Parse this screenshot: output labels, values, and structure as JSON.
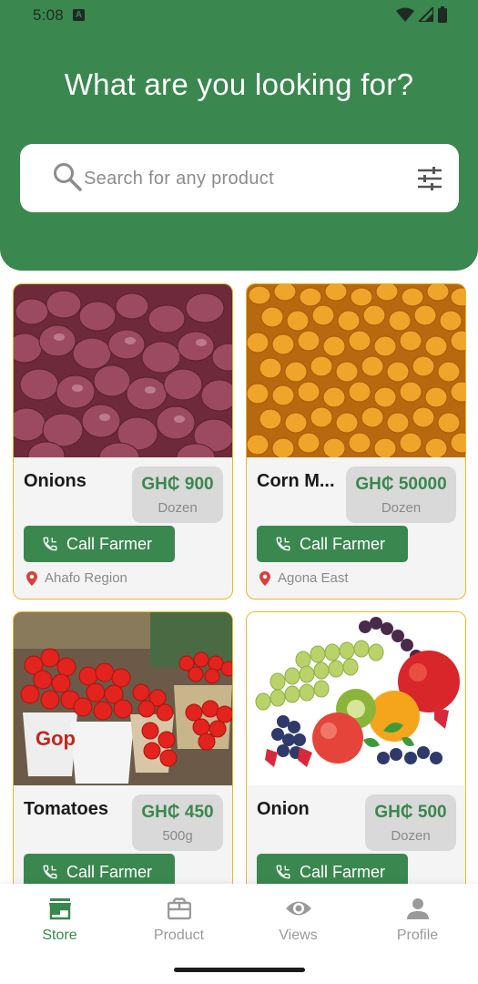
{
  "status_bar": {
    "time": "5:08",
    "notification_badge": "A"
  },
  "header": {
    "title": "What are you looking for?"
  },
  "search": {
    "placeholder": "Search for any product"
  },
  "products": [
    {
      "name": "Onions",
      "price": "GH₵ 900",
      "unit": "Dozen",
      "button": "Call Farmer",
      "location": "Ahafo Region",
      "image": "red onions pile"
    },
    {
      "name": "Corn M...",
      "price": "GH₵ 50000",
      "unit": "Dozen",
      "button": "Call Farmer",
      "location": "Agona East",
      "image": "corn kernels"
    },
    {
      "name": "Tomatoes",
      "price": "GH₵ 450",
      "unit": "500g",
      "button": "Call Farmer",
      "location": "",
      "image": "tomatoes in buckets"
    },
    {
      "name": "Onion",
      "price": "GH₵ 500",
      "unit": "Dozen",
      "button": "Call Farmer",
      "location": "",
      "image": "mixed fruits"
    }
  ],
  "nav": {
    "store": "Store",
    "product": "Product",
    "views": "Views",
    "profile": "Profile"
  },
  "colors": {
    "primary": "#3a874f",
    "card_border": "#e8b923",
    "card_bg": "#f4f4f4",
    "price_bg": "#d9d9d9"
  }
}
